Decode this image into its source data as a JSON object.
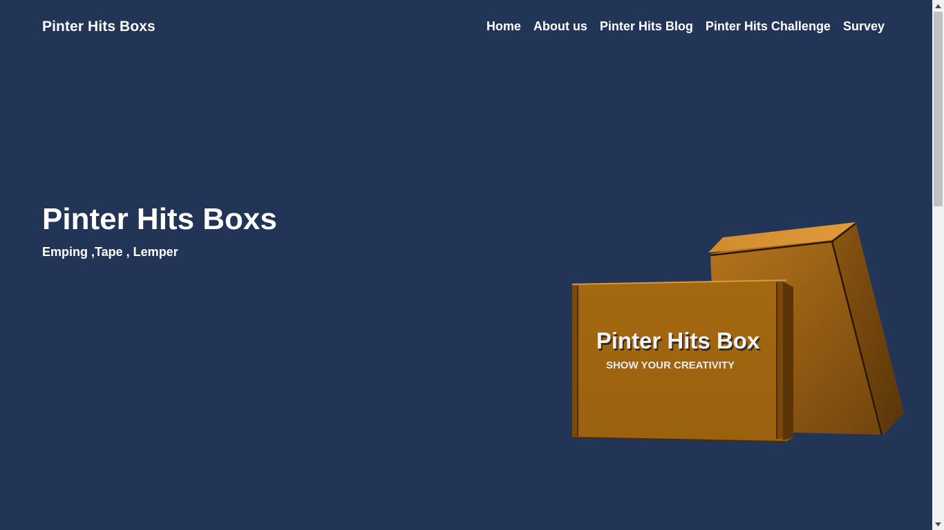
{
  "header": {
    "brand": "Pinter Hits Boxs",
    "nav": [
      {
        "label": "Home"
      },
      {
        "label": "About us"
      },
      {
        "label": "Pinter Hits Blog"
      },
      {
        "label": "Pinter Hits Challenge"
      },
      {
        "label": "Survey"
      }
    ]
  },
  "hero": {
    "title": "Pinter Hits Boxs",
    "subtitle": "Emping ,Tape , Lemper",
    "image": {
      "box_title": "Pinter Hits Box",
      "box_tagline": "SHOW YOUR CREATIVITY"
    }
  },
  "colors": {
    "background": "#223557",
    "text": "#ffffff",
    "box_front": "#a56a17",
    "box_back": "#b9761c"
  },
  "scrollbar": {
    "position_fraction": 0.0
  }
}
